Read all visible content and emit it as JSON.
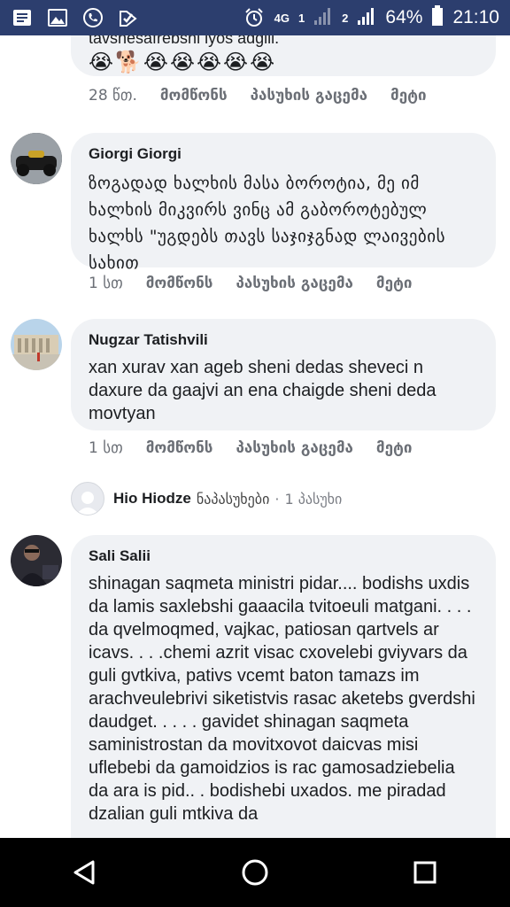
{
  "statusbar": {
    "network": "4G",
    "sim1": "1",
    "sim2": "2",
    "battery": "64%",
    "time": "21:10",
    "icons": [
      "notification-icon",
      "image-icon",
      "call-icon",
      "check-icon",
      "alarm-icon",
      "signal-icon",
      "battery-icon"
    ]
  },
  "top_comment": {
    "partial_text": "tavshesafrebshi iyos adgili.",
    "emoji_line_1": "🐕😭😭😭😭😭",
    "emoji_line_2": "😭🐕😭😭😭😭😭",
    "time": "28 წთ.",
    "like": "მომწონს",
    "reply": "პასუხის გაცემა",
    "more": "მეტი"
  },
  "comments": [
    {
      "author": "Giorgi Giorgi",
      "text": "ზოგადად ხალხის მასა ბოროტია, მე იმ ხალხის მიკვირს ვინც ამ გაბოროტებულ ხალხს \"უგდებს თავს საჯიჯგნად ლაივების სახით",
      "time": "1 სთ",
      "like": "მომწონს",
      "reply": "პასუხის გაცემა",
      "more": "მეტი"
    },
    {
      "author": "Nugzar Tatishvili",
      "text": "xan xurav xan ageb sheni dedas sheveci n daxure da gaajvi an ena chaigde sheni deda movtyan",
      "time": "1 სთ",
      "like": "მომწონს",
      "reply": "პასუხის გაცემა",
      "more": "მეტი"
    },
    {
      "author": "Sali Salii",
      "text": "shinagan saqmeta ministri pidar.... bodishs uxdis da lamis saxlebshi gaaacila tvitoeuli matgani. . . . da qvelmoqmed, vajkac, patiosan qartvels ar icavs. . . .chemi azrit visac cxovelebi gviyvars da guli gvtkiva, pativs vcemt baton tamazs im arachveulebrivi siketistvis rasac aketebs gverdshi daudget. . . . . gavidet shinagan saqmeta saministrostan da movitxovot daicvas misi uflebebi da gamoidzios is rac gamosadziebelia da ara is pid.. . bodishebi uxados. me piradad dzalian guli mtkiva da"
    }
  ],
  "reply_summary": {
    "name": "Hio Hiodze",
    "action": "ნაპასუხები",
    "separator": "·",
    "count": "1 პასუხი"
  },
  "navbar": {
    "icons": [
      "back-icon",
      "home-icon",
      "recents-icon"
    ]
  }
}
